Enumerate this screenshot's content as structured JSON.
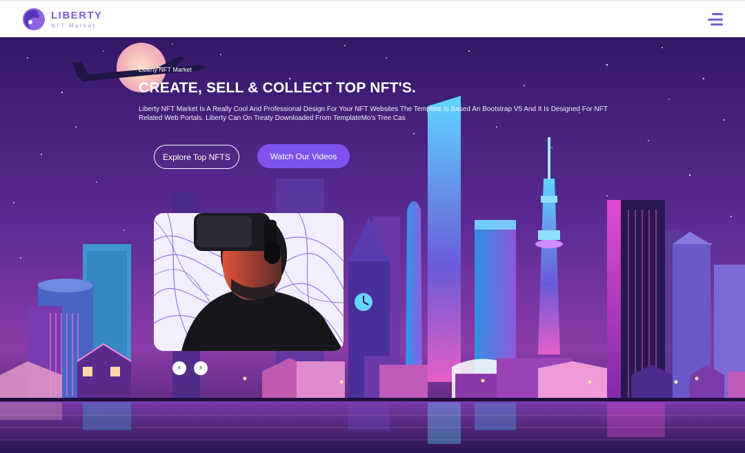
{
  "brand": {
    "name": "LIBERTY",
    "subtitle": "NFT Market",
    "accent": "#7b5bd6"
  },
  "navbar": {
    "menu_icon": "hamburger-menu-icon"
  },
  "hero": {
    "kicker": "Liberty NFT Market",
    "title": "CREATE, SELL & COLLECT TOP NFT'S.",
    "description": "Liberty NFT Market Is A Really Cool And Professional Design For Your NFT Websites The Template Is Based An Bootstrap V5 And It Is Designed For NFT Related Web Portals. Liberty Can On Treaty Downloaded From TemplateMo's Tree Cas",
    "primary_button": "Explore Top NFTS",
    "secondary_button": "Watch Our Videos",
    "button_accent": "#7e52ec"
  },
  "carousel": {
    "prev_label": "‹",
    "next_label": "›",
    "image_icon": "vr-headset-portrait"
  }
}
